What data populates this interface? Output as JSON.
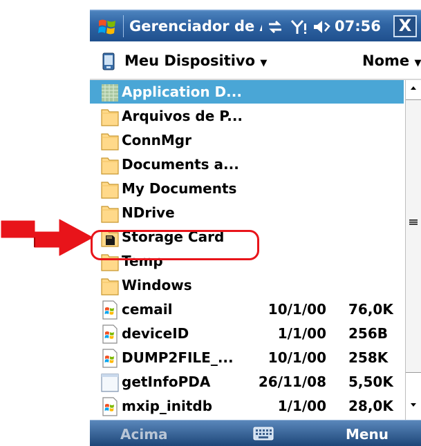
{
  "titlebar": {
    "title": "Gerenciador de Arquivos",
    "clock": "07:56",
    "close_label": "X"
  },
  "location": {
    "folder_label": "Meu Dispositivo",
    "sort_label": "Nome"
  },
  "files": [
    {
      "name": "Application D...",
      "date": "",
      "size": "",
      "icon": "special-folder-icon",
      "selected": true
    },
    {
      "name": "Arquivos de P...",
      "date": "",
      "size": "",
      "icon": "folder-icon"
    },
    {
      "name": "ConnMgr",
      "date": "",
      "size": "",
      "icon": "folder-icon"
    },
    {
      "name": "Documents a...",
      "date": "",
      "size": "",
      "icon": "folder-icon"
    },
    {
      "name": "My Documents",
      "date": "",
      "size": "",
      "icon": "folder-icon"
    },
    {
      "name": "NDrive",
      "date": "",
      "size": "",
      "icon": "folder-icon"
    },
    {
      "name": "Storage Card",
      "date": "",
      "size": "",
      "icon": "storage-card-icon"
    },
    {
      "name": "Temp",
      "date": "",
      "size": "",
      "icon": "folder-icon"
    },
    {
      "name": "Windows",
      "date": "",
      "size": "",
      "icon": "folder-icon"
    },
    {
      "name": "cemail",
      "date": "10/1/00",
      "size": "76,0K",
      "icon": "program-file-icon"
    },
    {
      "name": "deviceID",
      "date": "1/1/00",
      "size": "256B",
      "icon": "program-file-icon"
    },
    {
      "name": "DUMP2FILE_...",
      "date": "10/1/00",
      "size": "258K",
      "icon": "program-file-icon"
    },
    {
      "name": "getInfoPDA",
      "date": "26/11/08",
      "size": "5,50K",
      "icon": "blank-file-icon"
    },
    {
      "name": "mxip_initdb",
      "date": "1/1/00",
      "size": "28,0K",
      "icon": "program-file-icon"
    }
  ],
  "softkeys": {
    "left": "Acima",
    "right": "Menu"
  },
  "colors": {
    "selection": "#4aa6d6",
    "titlebar": "#2f64a3",
    "annotation_red": "#e8141a"
  }
}
